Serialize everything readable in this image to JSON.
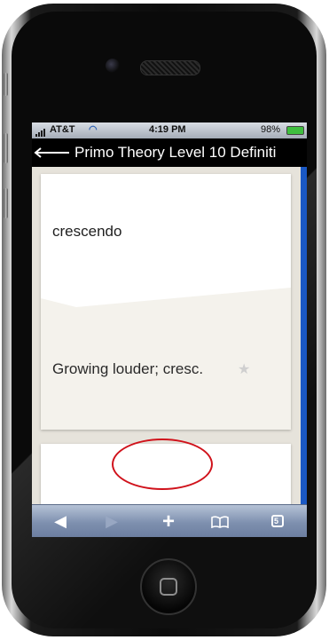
{
  "status_bar": {
    "carrier": "AT&T",
    "time": "4:19 PM",
    "battery": "98%"
  },
  "nav": {
    "title": "Primo Theory Level 10 Definiti"
  },
  "card": {
    "term": "crescendo",
    "definition": "Growing louder; cresc."
  },
  "toolbar": {
    "back_icon": "back-arrow-icon",
    "forward_icon": "forward-arrow-icon",
    "add_icon": "plus-icon",
    "bookmarks_icon": "book-icon",
    "pages_icon": "pages-icon",
    "pages_count": "5"
  },
  "colors": {
    "accent_scroll": "#1a58c4",
    "highlight": "#d0121b",
    "toolbar": "#7d8fae"
  }
}
